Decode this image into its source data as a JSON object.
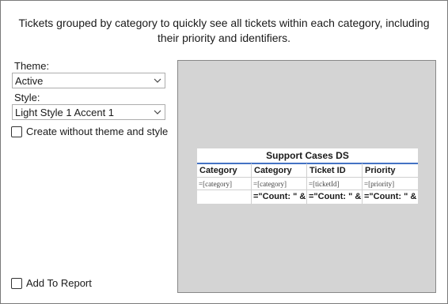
{
  "description": "Tickets grouped by category to quickly see all tickets within each category, including their priority and identifiers.",
  "theme": {
    "label": "Theme:",
    "value": "Active"
  },
  "style": {
    "label": "Style:",
    "value": "Light Style 1 Accent 1"
  },
  "create_without_theme": {
    "label": "Create without theme and style",
    "checked": false
  },
  "add_to_report": {
    "label": "Add To Report",
    "checked": false
  },
  "preview": {
    "title": "Support Cases DS",
    "accent_color": "#4472c4",
    "headers": [
      "Category",
      "Category",
      "Ticket ID",
      "Priority"
    ],
    "detail_row": [
      "=[category]",
      "=[category]",
      "=[ticketId]",
      "=[priority]"
    ],
    "total_row": [
      "",
      "=\"Count: \" &",
      "=\"Count: \" &",
      "=\"Count: \" &"
    ]
  }
}
